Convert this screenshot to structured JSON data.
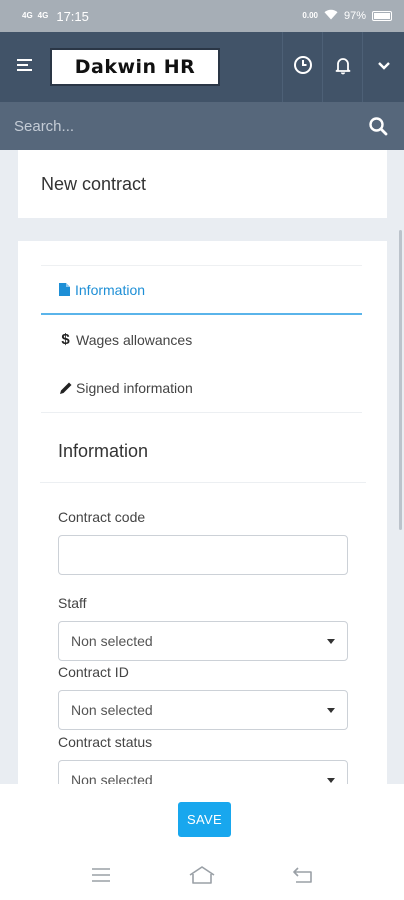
{
  "status_bar": {
    "signal_1": "4G",
    "signal_2": "4G",
    "time": "17:15",
    "speed": "0.00",
    "battery": "97%",
    "battery_level": 0.97
  },
  "header": {
    "logo_text": "Dakwin HR"
  },
  "search": {
    "placeholder": "Search..."
  },
  "page": {
    "title": "New contract"
  },
  "tabs": [
    {
      "label": "Information",
      "icon": "document-icon",
      "active": true
    },
    {
      "label": "Wages allowances",
      "icon": "dollar-icon",
      "active": false
    },
    {
      "label": "Signed information",
      "icon": "pencil-icon",
      "active": false
    }
  ],
  "form": {
    "section_title": "Information",
    "contract_code_label": "Contract code",
    "contract_code_value": "",
    "staff_label": "Staff",
    "staff_value": "Non selected",
    "contract_id_label": "Contract ID",
    "contract_id_value": "Non selected",
    "contract_status_label": "Contract status",
    "contract_status_value": "Non selected"
  },
  "footer": {
    "save_label": "SAVE"
  },
  "colors": {
    "header_bg": "#415368",
    "search_bg": "#56677b",
    "accent": "#1e8fd6",
    "save_button": "#18a7ee"
  }
}
